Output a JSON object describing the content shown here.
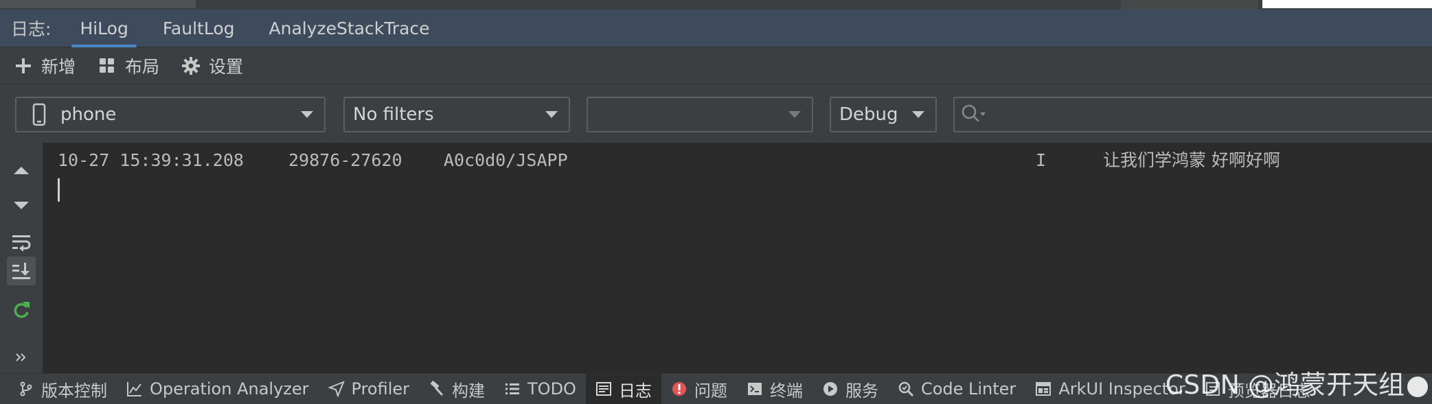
{
  "log_tabs": {
    "label": "日志:",
    "tabs": [
      {
        "label": "HiLog",
        "active": true
      },
      {
        "label": "FaultLog",
        "active": false
      },
      {
        "label": "AnalyzeStackTrace",
        "active": false
      }
    ]
  },
  "toolbar": {
    "add_label": "新增",
    "layout_label": "布局",
    "settings_label": "设置"
  },
  "filters": {
    "device": "phone",
    "filter": "No filters",
    "process": "",
    "level": "Debug",
    "search_placeholder": ""
  },
  "log": {
    "entries": [
      {
        "time": "10-27 15:39:31.208",
        "pid": "29876-27620",
        "tag": "A0c0d0/JSAPP",
        "level": "I",
        "message": "让我们学鸿蒙 好啊好啊"
      }
    ]
  },
  "statusbar": {
    "items": [
      {
        "label": "版本控制",
        "icon": "branch-icon"
      },
      {
        "label": "Operation Analyzer",
        "icon": "chart-line-icon"
      },
      {
        "label": "Profiler",
        "icon": "profiler-icon"
      },
      {
        "label": "构建",
        "icon": "hammer-icon"
      },
      {
        "label": "TODO",
        "icon": "list-icon"
      },
      {
        "label": "日志",
        "icon": "log-icon"
      },
      {
        "label": "问题",
        "icon": "error-icon"
      },
      {
        "label": "终端",
        "icon": "terminal-icon"
      },
      {
        "label": "服务",
        "icon": "play-icon"
      },
      {
        "label": "Code Linter",
        "icon": "linter-icon"
      },
      {
        "label": "ArkUI Inspector",
        "icon": "inspector-icon"
      },
      {
        "label": "预览器日志",
        "icon": "preview-log-icon"
      }
    ],
    "active_index": 5
  },
  "watermark": "CSDN @鸿蒙开天组",
  "colors": {
    "accent": "#4a88c7",
    "tab_header_bg": "#3d4b5c",
    "panel_bg": "#3c3f41",
    "log_bg": "#2b2b2b",
    "error": "#e05555",
    "rerun": "#4caf50"
  }
}
